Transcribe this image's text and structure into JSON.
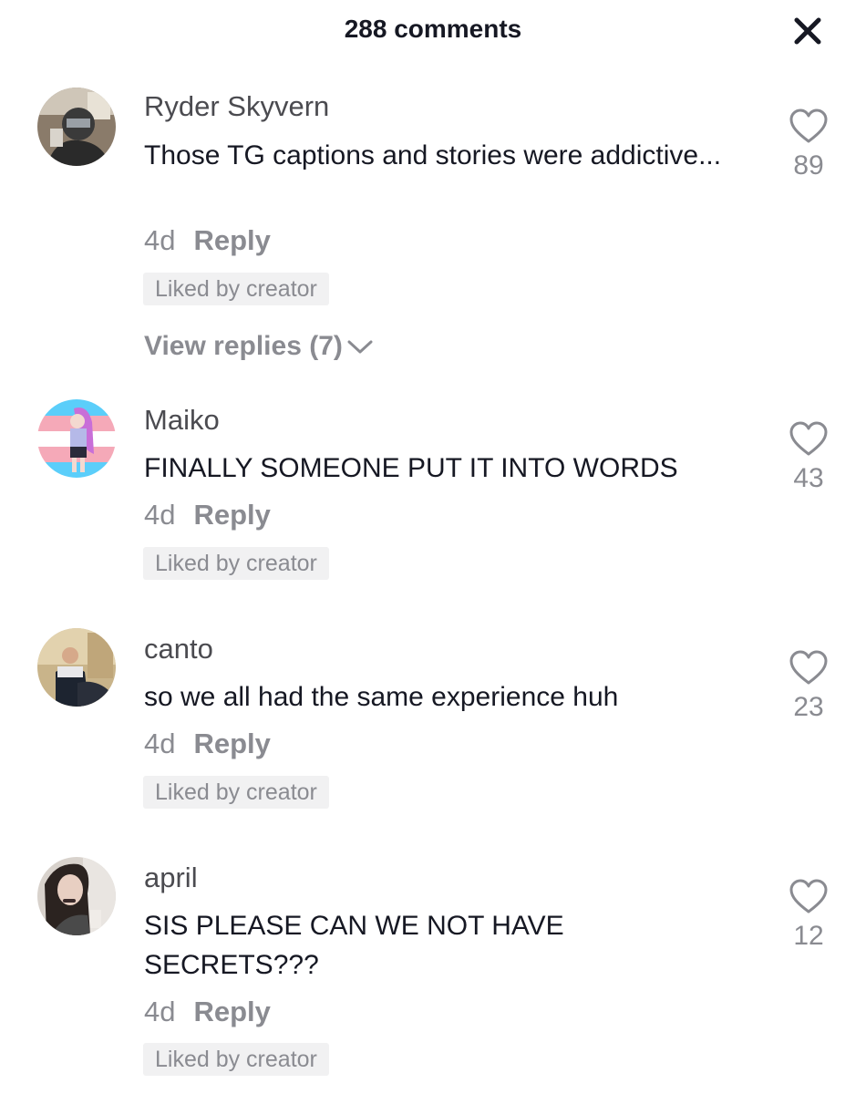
{
  "header": {
    "title": "288 comments",
    "close_icon": "close-icon"
  },
  "colors": {
    "text": "#161823",
    "secondary": "#8a8b91",
    "username": "#4b4b50",
    "badge_bg": "#f1f1f2"
  },
  "comments": [
    {
      "username": "Ryder Skyvern",
      "text": "Those TG captions and stories were addictive...",
      "time": "4d",
      "reply_label": "Reply",
      "badge": "Liked by creator",
      "likes": "89",
      "view_replies": "View replies (7)"
    },
    {
      "username": "Maiko",
      "text": "FINALLY SOMEONE PUT IT INTO WORDS",
      "time": "4d",
      "reply_label": "Reply",
      "badge": "Liked by creator",
      "likes": "43"
    },
    {
      "username": "canto",
      "text": "so we all had the same experience huh",
      "time": "4d",
      "reply_label": "Reply",
      "badge": "Liked by creator",
      "likes": "23"
    },
    {
      "username": "april",
      "text": "SIS PLEASE CAN WE NOT HAVE SECRETS???",
      "time": "4d",
      "reply_label": "Reply",
      "badge": "Liked by creator",
      "likes": "12"
    }
  ]
}
